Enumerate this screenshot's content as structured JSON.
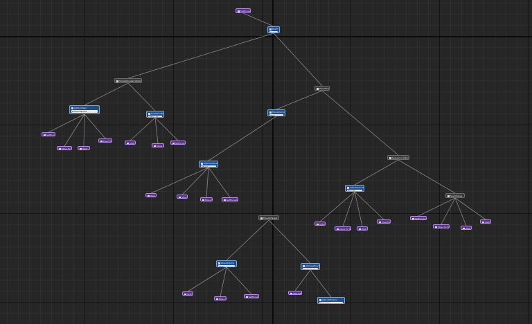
{
  "graph": {
    "root_label": "SetFocusActor",
    "nodes": [
      {
        "id": "root",
        "kind": "leaf",
        "label": "SetFocusActor"
      },
      {
        "id": "entry",
        "kind": "task",
        "label": "ROOT",
        "sub": "Selector"
      },
      {
        "id": "simple_parallel",
        "kind": "composite",
        "label": "SimpleParallel AIPatrolTask"
      },
      {
        "id": "selector_main",
        "kind": "composite",
        "label": "MoveToActor"
      },
      {
        "id": "patrol_task",
        "kind": "task",
        "label": "AIPatrolTask",
        "sub": "DoPatrolRoute"
      },
      {
        "id": "find_point",
        "kind": "task",
        "label": "FindPatrolPoint",
        "sub": "AIMoveTo"
      },
      {
        "id": "move_task",
        "kind": "task",
        "label": "MoveToActor",
        "sub": "Wait"
      },
      {
        "id": "enemy_task",
        "kind": "task",
        "label": "AIMoveToEnemy",
        "sub": "Attack"
      },
      {
        "id": "sequence_attack",
        "kind": "composite",
        "label": "Sequence Attack"
      },
      {
        "id": "sequence_search",
        "kind": "composite",
        "label": "SearchArea"
      },
      {
        "id": "search_task",
        "kind": "task",
        "label": "AIFindSearchPoint",
        "sub": "MoveTo"
      },
      {
        "id": "move_composite",
        "kind": "composite",
        "label": "MoveToTarget"
      },
      {
        "id": "move_sub",
        "kind": "task",
        "label": "MoveToPoint",
        "sub": "Wait"
      },
      {
        "id": "chase_task",
        "kind": "task",
        "label": "AIChaseEnemy",
        "sub": "RunToEnemy"
      },
      {
        "id": "chase_sub",
        "kind": "task",
        "label": "AIRunToEnemy",
        "sub": "Sequence"
      },
      {
        "id": "l1",
        "kind": "leaf",
        "label": "SetFocus"
      },
      {
        "id": "l2",
        "kind": "leaf",
        "label": "Move To Target"
      },
      {
        "id": "l3",
        "kind": "leaf",
        "label": "Wait"
      },
      {
        "id": "l4",
        "kind": "leaf",
        "label": "ClearFocus"
      },
      {
        "id": "l5",
        "kind": "leaf",
        "label": "SetFocus"
      },
      {
        "id": "l6",
        "kind": "leaf",
        "label": "Move To"
      },
      {
        "id": "l7",
        "kind": "leaf",
        "label": "SetFocusActor"
      },
      {
        "id": "l8",
        "kind": "leaf",
        "label": "Wait"
      },
      {
        "id": "l9",
        "kind": "leaf",
        "label": "Attack"
      },
      {
        "id": "l10",
        "kind": "leaf",
        "label": "Move To"
      },
      {
        "id": "l11",
        "kind": "leaf",
        "label": "SetFocusActor"
      },
      {
        "id": "l12",
        "kind": "leaf",
        "label": "SetFocus"
      },
      {
        "id": "l13",
        "kind": "leaf",
        "label": "Move To Target"
      },
      {
        "id": "l14",
        "kind": "leaf",
        "label": "Wait"
      },
      {
        "id": "l15",
        "kind": "leaf",
        "label": "ClearFocus"
      },
      {
        "id": "l16",
        "kind": "leaf",
        "label": "SetFocusActor"
      },
      {
        "id": "l17",
        "kind": "leaf",
        "label": "Move To Target"
      },
      {
        "id": "l18",
        "kind": "leaf",
        "label": "Wait"
      },
      {
        "id": "l19",
        "kind": "leaf",
        "label": "Wait"
      },
      {
        "id": "l20",
        "kind": "leaf",
        "label": "SetFocus"
      },
      {
        "id": "l21",
        "kind": "leaf",
        "label": "Move To"
      },
      {
        "id": "l22",
        "kind": "leaf",
        "label": "SetFocusActor"
      },
      {
        "id": "l23",
        "kind": "leaf",
        "label": "AttackEnemy"
      }
    ],
    "edges": [
      [
        "root",
        "entry"
      ],
      [
        "entry",
        "simple_parallel"
      ],
      [
        "entry",
        "selector_main"
      ],
      [
        "simple_parallel",
        "patrol_task"
      ],
      [
        "simple_parallel",
        "find_point"
      ],
      [
        "patrol_task",
        "l1"
      ],
      [
        "patrol_task",
        "l2"
      ],
      [
        "patrol_task",
        "l3"
      ],
      [
        "patrol_task",
        "l4"
      ],
      [
        "find_point",
        "l5"
      ],
      [
        "find_point",
        "l6"
      ],
      [
        "find_point",
        "l7"
      ],
      [
        "selector_main",
        "move_task"
      ],
      [
        "selector_main",
        "sequence_attack"
      ],
      [
        "move_task",
        "enemy_task"
      ],
      [
        "enemy_task",
        "l8"
      ],
      [
        "enemy_task",
        "l9"
      ],
      [
        "enemy_task",
        "l10"
      ],
      [
        "enemy_task",
        "l11"
      ],
      [
        "sequence_attack",
        "search_task"
      ],
      [
        "sequence_attack",
        "sequence_search"
      ],
      [
        "search_task",
        "l12"
      ],
      [
        "search_task",
        "l13"
      ],
      [
        "search_task",
        "l14"
      ],
      [
        "search_task",
        "l15"
      ],
      [
        "sequence_search",
        "l16"
      ],
      [
        "sequence_search",
        "l17"
      ],
      [
        "sequence_search",
        "l18"
      ],
      [
        "sequence_search",
        "l19"
      ],
      [
        "move_composite",
        "move_sub"
      ],
      [
        "move_composite",
        "chase_task"
      ],
      [
        "move_sub",
        "l20"
      ],
      [
        "move_sub",
        "l21"
      ],
      [
        "move_sub",
        "l22"
      ],
      [
        "chase_task",
        "l23"
      ],
      [
        "chase_task",
        "chase_sub"
      ]
    ]
  }
}
